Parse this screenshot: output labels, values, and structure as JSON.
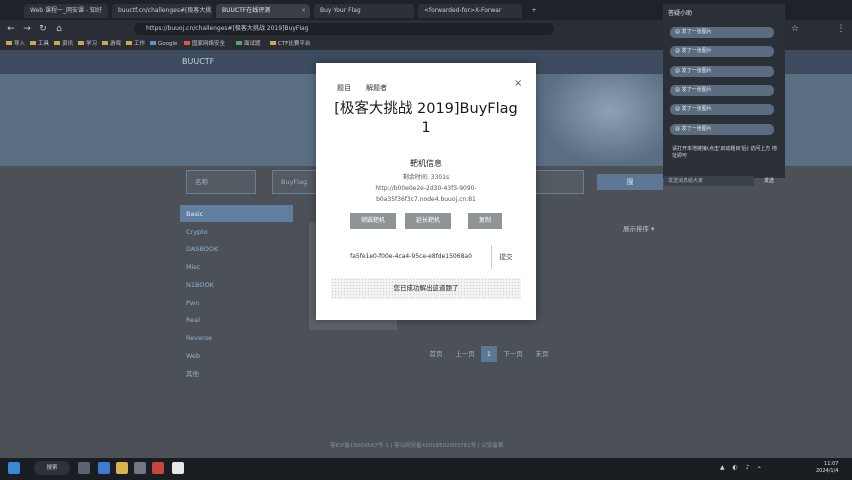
{
  "browser": {
    "tabs": [
      {
        "label": "Web 课程一_网安课 - 知好"
      },
      {
        "label": "buuctf.cn/challenges#[极客大挑"
      },
      {
        "label": "BUUCTF在线评测"
      },
      {
        "label": "Buy Your Flag"
      },
      {
        "label": "<forwarded-for>X-Forwar"
      }
    ],
    "url": "https://buuoj.cn/challenges#[极客大挑战 2019]BuyFlag",
    "bookmarks": [
      "导入",
      "工具",
      "资讯",
      "学习",
      "游戏",
      "工作",
      "Google",
      "国家网络安全",
      "面试题",
      "CTF比赛平台"
    ]
  },
  "site": {
    "brand": "BUUCTF",
    "search_placeholder": "名称",
    "tag_placeholder": "BuyFlag",
    "search_button": "搜",
    "categories": [
      "Basic",
      "Crypto",
      "DASBOOK",
      "Misc",
      "N1BOOK",
      "Pwn",
      "Real",
      "Reverse",
      "Web",
      "其他"
    ],
    "sort_label": "展示排序",
    "pagination": [
      "首页",
      "上一页",
      "1",
      "下一页",
      "末页"
    ],
    "footer": "鄂ICP备19004567号-1 | 鄂公网安备42018502003781号 | 公安备案"
  },
  "notifications": {
    "title": "答疑小助",
    "items": [
      "@ 发了一张图片",
      "@ 发了一张图片",
      "@ 发了一张图片",
      "@ 发了一张图片",
      "@ 发了一张图片",
      "@ 发了一张图片"
    ],
    "message": "请打开本地链接(点击'启动题目'后) 访问上方 地址即可",
    "input_placeholder": "发送消息给大家",
    "send": "发送"
  },
  "modal": {
    "tabs": [
      "题目",
      "解题者"
    ],
    "close": "×",
    "title": "[极客大挑战 2019]BuyFlag",
    "points": "1",
    "subtitle": "靶机信息",
    "remaining": "剩余时间: 3301s",
    "url_line1": "http://b00e0e2e-2d30-43f3-9090-",
    "url_line2": "b0a35f36f3c7.node4.buuoj.cn:81",
    "buttons": [
      "销毁靶机",
      "延长靶机",
      "复制"
    ],
    "flag_value": "fa5fe1e0-f00e-4ca4-95ce-e8fde15068a0",
    "submit": "提交",
    "solved": "您已成功解出这道题了"
  },
  "taskbar": {
    "search": "搜索",
    "time": "11:07",
    "date": "2024/1/4"
  }
}
